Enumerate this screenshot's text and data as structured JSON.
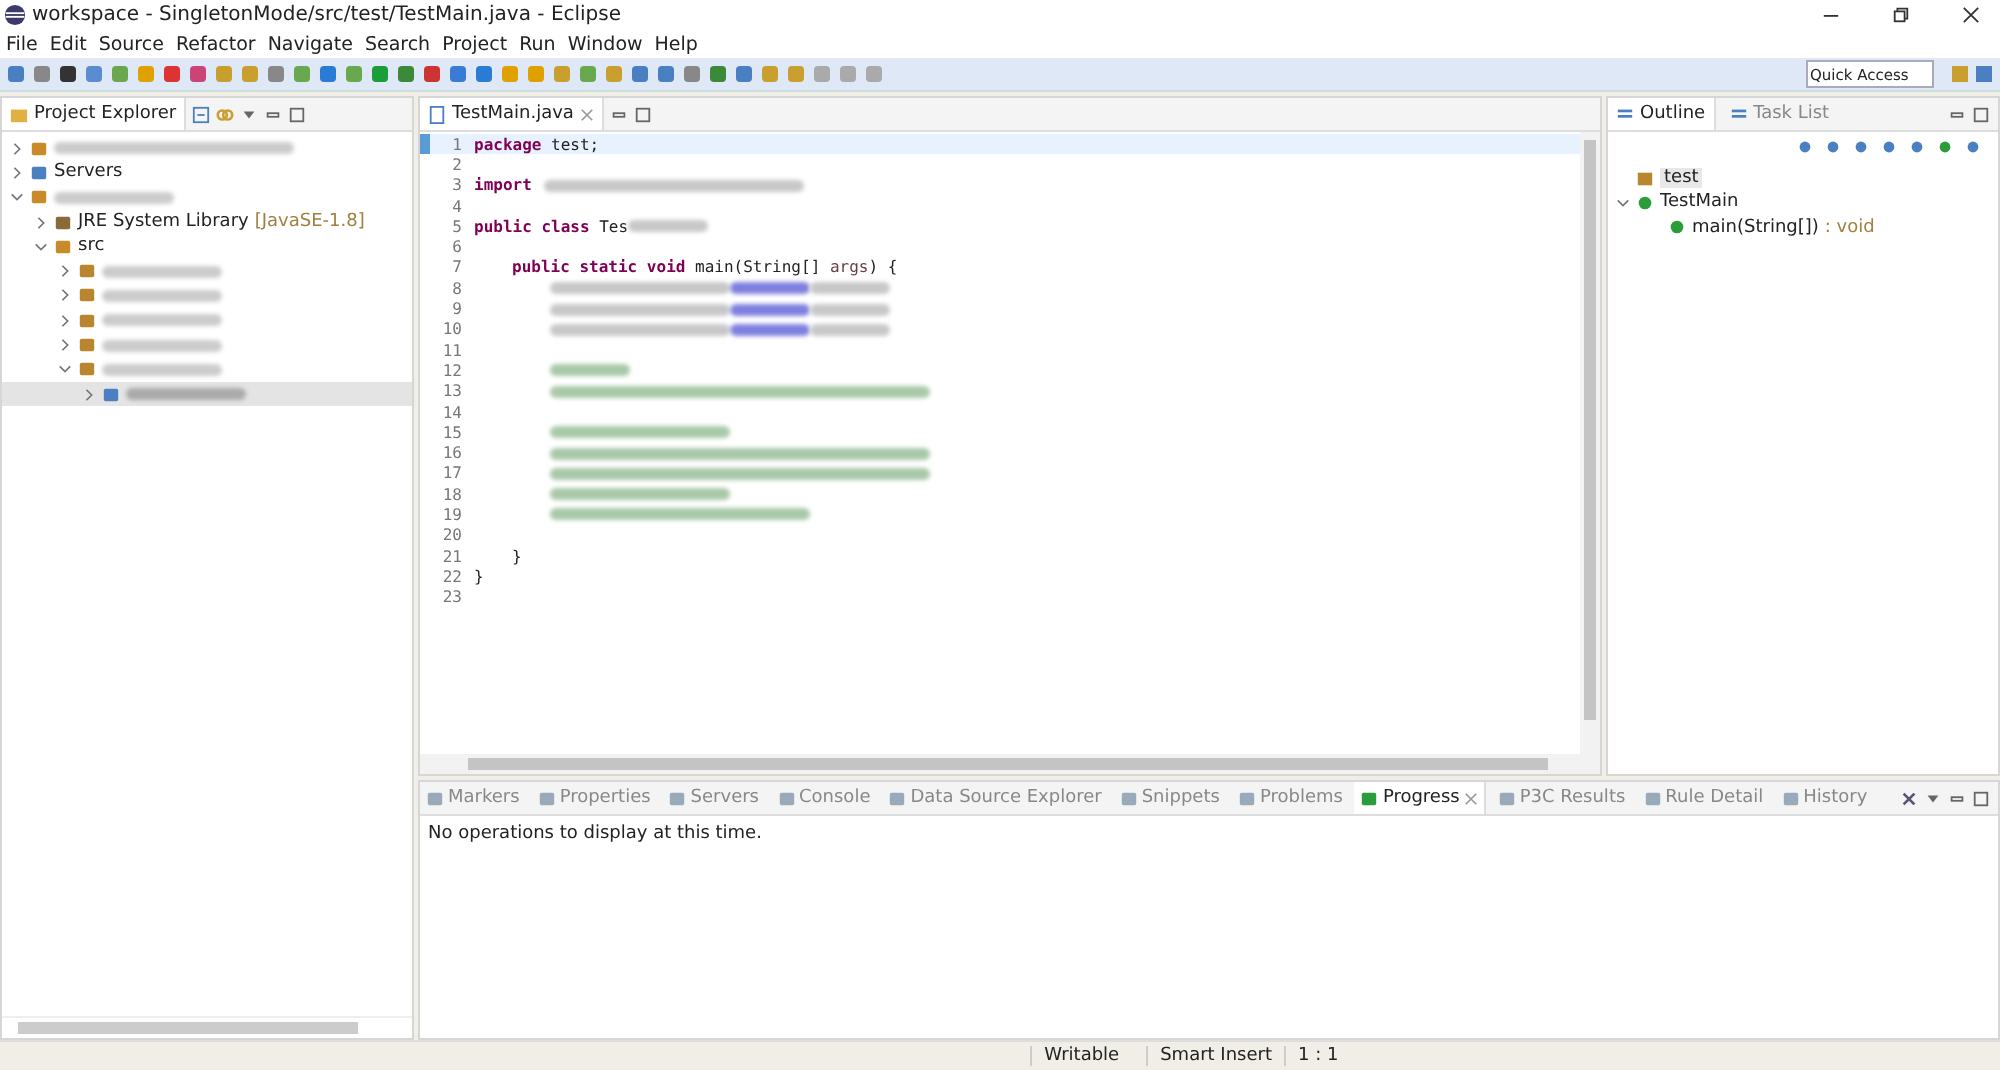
{
  "window": {
    "title": "workspace - SingletonMode/src/test/TestMain.java - Eclipse"
  },
  "menu": [
    "File",
    "Edit",
    "Source",
    "Refactor",
    "Navigate",
    "Search",
    "Project",
    "Run",
    "Window",
    "Help"
  ],
  "quick_access": {
    "placeholder": "Quick Access"
  },
  "project_explorer": {
    "title": "Project Explorer",
    "items": [
      {
        "kind": "project",
        "expanded": false,
        "selected": false
      },
      {
        "kind": "folder",
        "label": "Servers",
        "expanded": false,
        "selected": false
      },
      {
        "kind": "project",
        "expanded": true,
        "selected": false,
        "children": [
          {
            "kind": "library",
            "label": "JRE System Library",
            "suffix": "[JavaSE-1.8]",
            "expanded": false,
            "selected": false
          },
          {
            "kind": "source",
            "label": "src",
            "expanded": true,
            "selected": false,
            "children": [
              {
                "kind": "package",
                "expanded": false,
                "selected": false
              },
              {
                "kind": "package",
                "expanded": false,
                "selected": false
              },
              {
                "kind": "package",
                "expanded": false,
                "selected": false
              },
              {
                "kind": "package",
                "expanded": false,
                "selected": false
              },
              {
                "kind": "package",
                "expanded": true,
                "selected": false,
                "children": [
                  {
                    "kind": "file",
                    "expanded": false,
                    "selected": true
                  }
                ]
              }
            ]
          }
        ]
      }
    ]
  },
  "editor": {
    "tab": "TestMain.java",
    "lines": [
      {
        "number": "1",
        "current": true,
        "tokens": [
          {
            "kind": "keyword",
            "text": "package"
          },
          {
            "kind": "plain",
            "text": " test;"
          }
        ]
      },
      {
        "number": "2",
        "current": false
      },
      {
        "number": "3",
        "current": false,
        "tokens": [
          {
            "kind": "keyword",
            "text": "import"
          },
          {
            "kind": "redacted"
          }
        ]
      },
      {
        "number": "4",
        "current": false
      },
      {
        "number": "5",
        "current": false,
        "tokens": [
          {
            "kind": "keyword",
            "text": "public class"
          },
          {
            "kind": "plain",
            "text": " Tes"
          },
          {
            "kind": "redacted"
          }
        ]
      },
      {
        "number": "6",
        "current": false
      },
      {
        "number": "7",
        "current": false,
        "tokens": [
          {
            "kind": "indent"
          },
          {
            "kind": "keyword",
            "text": "public static void"
          },
          {
            "kind": "plain",
            "text": " main(String[] "
          },
          {
            "kind": "param",
            "text": "args"
          },
          {
            "kind": "plain",
            "text": ") {"
          }
        ]
      },
      {
        "number": "8",
        "current": false,
        "tokens": [
          {
            "kind": "indent"
          },
          {
            "kind": "indent"
          },
          {
            "kind": "redacted"
          },
          {
            "kind": "redacted-field"
          },
          {
            "kind": "redacted"
          }
        ]
      },
      {
        "number": "9",
        "current": false,
        "tokens": [
          {
            "kind": "indent"
          },
          {
            "kind": "indent"
          },
          {
            "kind": "redacted"
          },
          {
            "kind": "redacted-field"
          },
          {
            "kind": "redacted"
          }
        ]
      },
      {
        "number": "10",
        "current": false,
        "tokens": [
          {
            "kind": "indent"
          },
          {
            "kind": "indent"
          },
          {
            "kind": "redacted"
          },
          {
            "kind": "redacted-field"
          },
          {
            "kind": "redacted"
          }
        ]
      },
      {
        "number": "11",
        "current": false
      },
      {
        "number": "12",
        "current": false,
        "tokens": [
          {
            "kind": "indent"
          },
          {
            "kind": "indent"
          },
          {
            "kind": "redacted-comment"
          }
        ]
      },
      {
        "number": "13",
        "current": false,
        "tokens": [
          {
            "kind": "indent"
          },
          {
            "kind": "indent"
          },
          {
            "kind": "redacted-comment"
          }
        ]
      },
      {
        "number": "14",
        "current": false
      },
      {
        "number": "15",
        "current": false,
        "tokens": [
          {
            "kind": "indent"
          },
          {
            "kind": "indent"
          },
          {
            "kind": "redacted-comment"
          }
        ]
      },
      {
        "number": "16",
        "current": false,
        "tokens": [
          {
            "kind": "indent"
          },
          {
            "kind": "indent"
          },
          {
            "kind": "redacted-comment"
          }
        ]
      },
      {
        "number": "17",
        "current": false,
        "tokens": [
          {
            "kind": "indent"
          },
          {
            "kind": "indent"
          },
          {
            "kind": "redacted-comment"
          }
        ]
      },
      {
        "number": "18",
        "current": false,
        "tokens": [
          {
            "kind": "indent"
          },
          {
            "kind": "indent"
          },
          {
            "kind": "redacted-comment"
          }
        ]
      },
      {
        "number": "19",
        "current": false,
        "tokens": [
          {
            "kind": "indent"
          },
          {
            "kind": "indent"
          },
          {
            "kind": "redacted-comment"
          }
        ]
      },
      {
        "number": "20",
        "current": false
      },
      {
        "number": "21",
        "current": false,
        "tokens": [
          {
            "kind": "indent"
          },
          {
            "kind": "plain",
            "text": "}"
          }
        ]
      },
      {
        "number": "22",
        "current": false,
        "tokens": [
          {
            "kind": "plain",
            "text": "}"
          }
        ]
      },
      {
        "number": "23",
        "current": false
      }
    ]
  },
  "outline": {
    "tabs": [
      {
        "label": "Outline",
        "selected": true
      },
      {
        "label": "Task List",
        "selected": false
      }
    ],
    "items": [
      {
        "kind": "package",
        "label": "test"
      },
      {
        "kind": "class",
        "label": "TestMain",
        "expanded": true,
        "children": [
          {
            "kind": "method",
            "label": "main(String[])",
            "detail": " : void"
          }
        ]
      }
    ]
  },
  "bottom_panel": {
    "tabs": [
      {
        "label": "Markers",
        "selected": false
      },
      {
        "label": "Properties",
        "selected": false
      },
      {
        "label": "Servers",
        "selected": false
      },
      {
        "label": "Console",
        "selected": false
      },
      {
        "label": "Data Source Explorer",
        "selected": false
      },
      {
        "label": "Snippets",
        "selected": false
      },
      {
        "label": "Problems",
        "selected": false
      },
      {
        "label": "Progress",
        "selected": true
      },
      {
        "label": "P3C Results",
        "selected": false
      },
      {
        "label": "Rule Detail",
        "selected": false
      },
      {
        "label": "History",
        "selected": false
      }
    ],
    "message": "No operations to display at this time."
  },
  "status_bar": [
    "Writable",
    "Smart Insert",
    "1 : 1"
  ]
}
